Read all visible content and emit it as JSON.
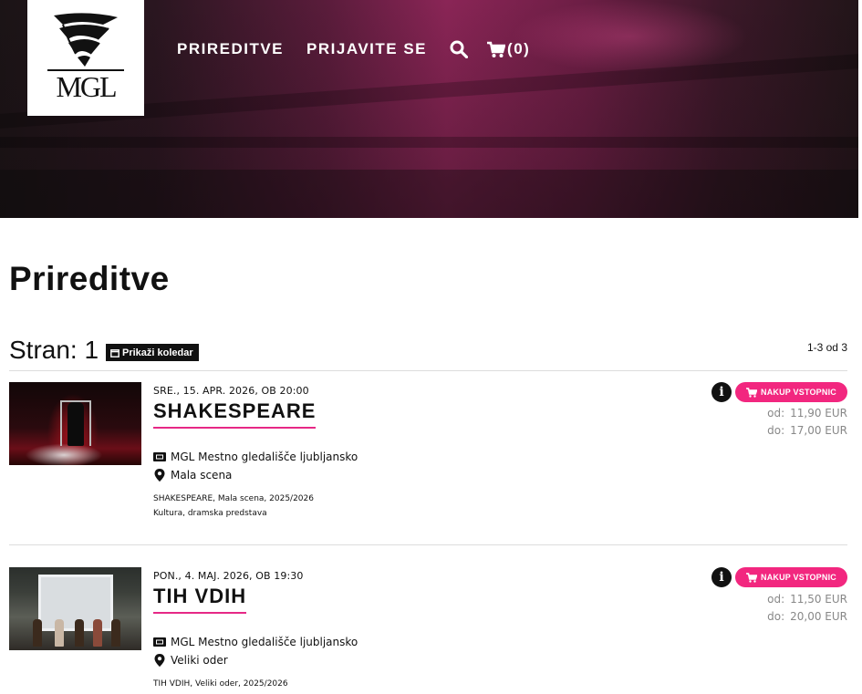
{
  "header": {
    "logo_text": "MGL",
    "nav": {
      "events": "PRIREDITVE",
      "login": "PRIJAVITE SE",
      "cart_count": "(0)"
    }
  },
  "page": {
    "title": "Prireditve",
    "pager": "Stran: 1",
    "calendar_button": "Prikaži koledar",
    "result_count": "1-3 od 3"
  },
  "events": [
    {
      "date": "SRE., 15. APR. 2026, OB 20:00",
      "title": "SHAKESPEARE",
      "venue": "MGL Mestno gledališče ljubljansko",
      "stage": "Mala scena",
      "meta1": "SHAKESPEARE, Mala scena, 2025/2026",
      "meta2": "Kultura, dramska predstava",
      "buy_label": "NAKUP VSTOPNIC",
      "price_from_label": "od:",
      "price_from": "11,90 EUR",
      "price_to_label": "do:",
      "price_to": "17,00 EUR"
    },
    {
      "date": "PON., 4. MAJ. 2026, OB 19:30",
      "title": "TIH VDIH",
      "venue": "MGL Mestno gledališče ljubljansko",
      "stage": "Veliki oder",
      "meta1": "TIH VDIH, Veliki oder, 2025/2026",
      "buy_label": "NAKUP VSTOPNIC",
      "price_from_label": "od:",
      "price_from": "11,50 EUR",
      "price_to_label": "do:",
      "price_to": "20,00 EUR"
    }
  ],
  "colors": {
    "accent": "#f2277f",
    "title_underline": "#e62886"
  }
}
